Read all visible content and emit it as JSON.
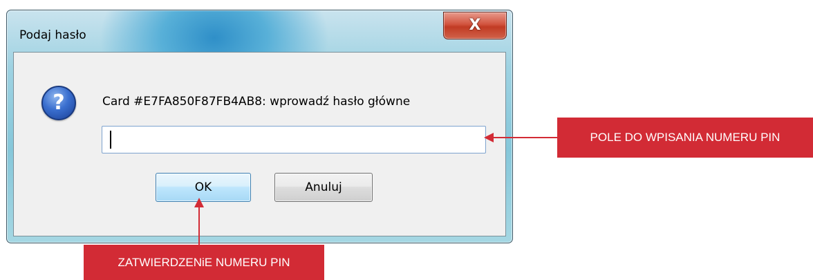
{
  "dialog": {
    "title": "Podaj hasło",
    "close_glyph": "X",
    "message": "Card #E7FA850F87FB4AB8: wprowadź hasło główne",
    "pin_input_value": "",
    "ok_label": "OK",
    "cancel_label": "Anuluj"
  },
  "annotations": {
    "pin_field_label": "POLE DO WPISANIA NUMERU PIN",
    "confirm_label": "ZATWIERDZENiE NUMERU PIN"
  },
  "colors": {
    "annotation_red": "#d22b35",
    "dialog_face": "#f0f0f0",
    "focused_button_border": "#3c7fb1"
  }
}
